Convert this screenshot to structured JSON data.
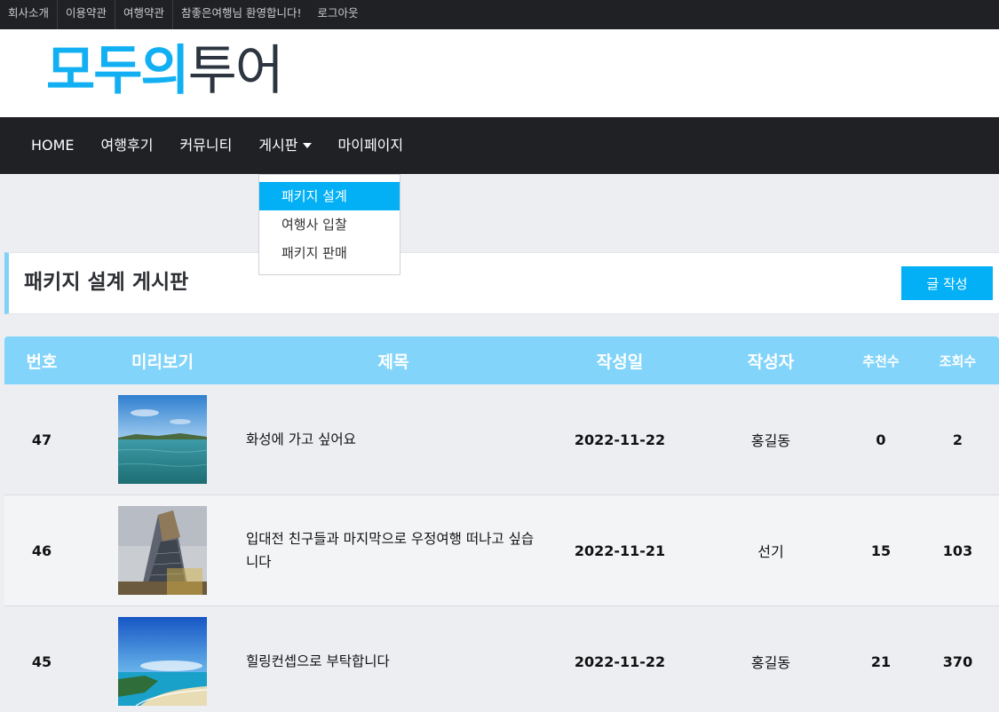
{
  "topbar": {
    "links": [
      "회사소개",
      "이용약관",
      "여행약관"
    ],
    "welcome": "참좋은여행님 환영합니다!",
    "logout": "로그아웃"
  },
  "logo": {
    "part1": "모두의",
    "part2": "투어"
  },
  "nav": {
    "items": [
      "HOME",
      "여행후기",
      "커뮤니티",
      "게시판",
      "마이페이지"
    ],
    "dropdown": [
      "패키지 설계",
      "여행사 입찰",
      "패키지 판매"
    ]
  },
  "board": {
    "title": "패키지 설계 게시판",
    "write_button": "글 작성"
  },
  "table": {
    "headers": [
      "번호",
      "미리보기",
      "제목",
      "작성일",
      "작성자",
      "추천수",
      "조회수"
    ],
    "rows": [
      {
        "no": "47",
        "title": "화성에 가고 싶어요",
        "date": "2022-11-22",
        "author": "홍길동",
        "recommend": "0",
        "views": "2",
        "thumb": "sea-icon"
      },
      {
        "no": "46",
        "title": "입대전 친구들과 마지막으로 우정여행 떠나고 싶습니다",
        "date": "2022-11-21",
        "author": "선기",
        "recommend": "15",
        "views": "103",
        "thumb": "building-icon"
      },
      {
        "no": "45",
        "title": "힐링컨셉으로 부탁합니다",
        "date": "2022-11-22",
        "author": "홍길동",
        "recommend": "21",
        "views": "370",
        "thumb": "beach-icon"
      }
    ]
  },
  "colors": {
    "accent": "#03b0f5",
    "header_row": "#82d4fa",
    "dark_bar": "#1f2124"
  }
}
